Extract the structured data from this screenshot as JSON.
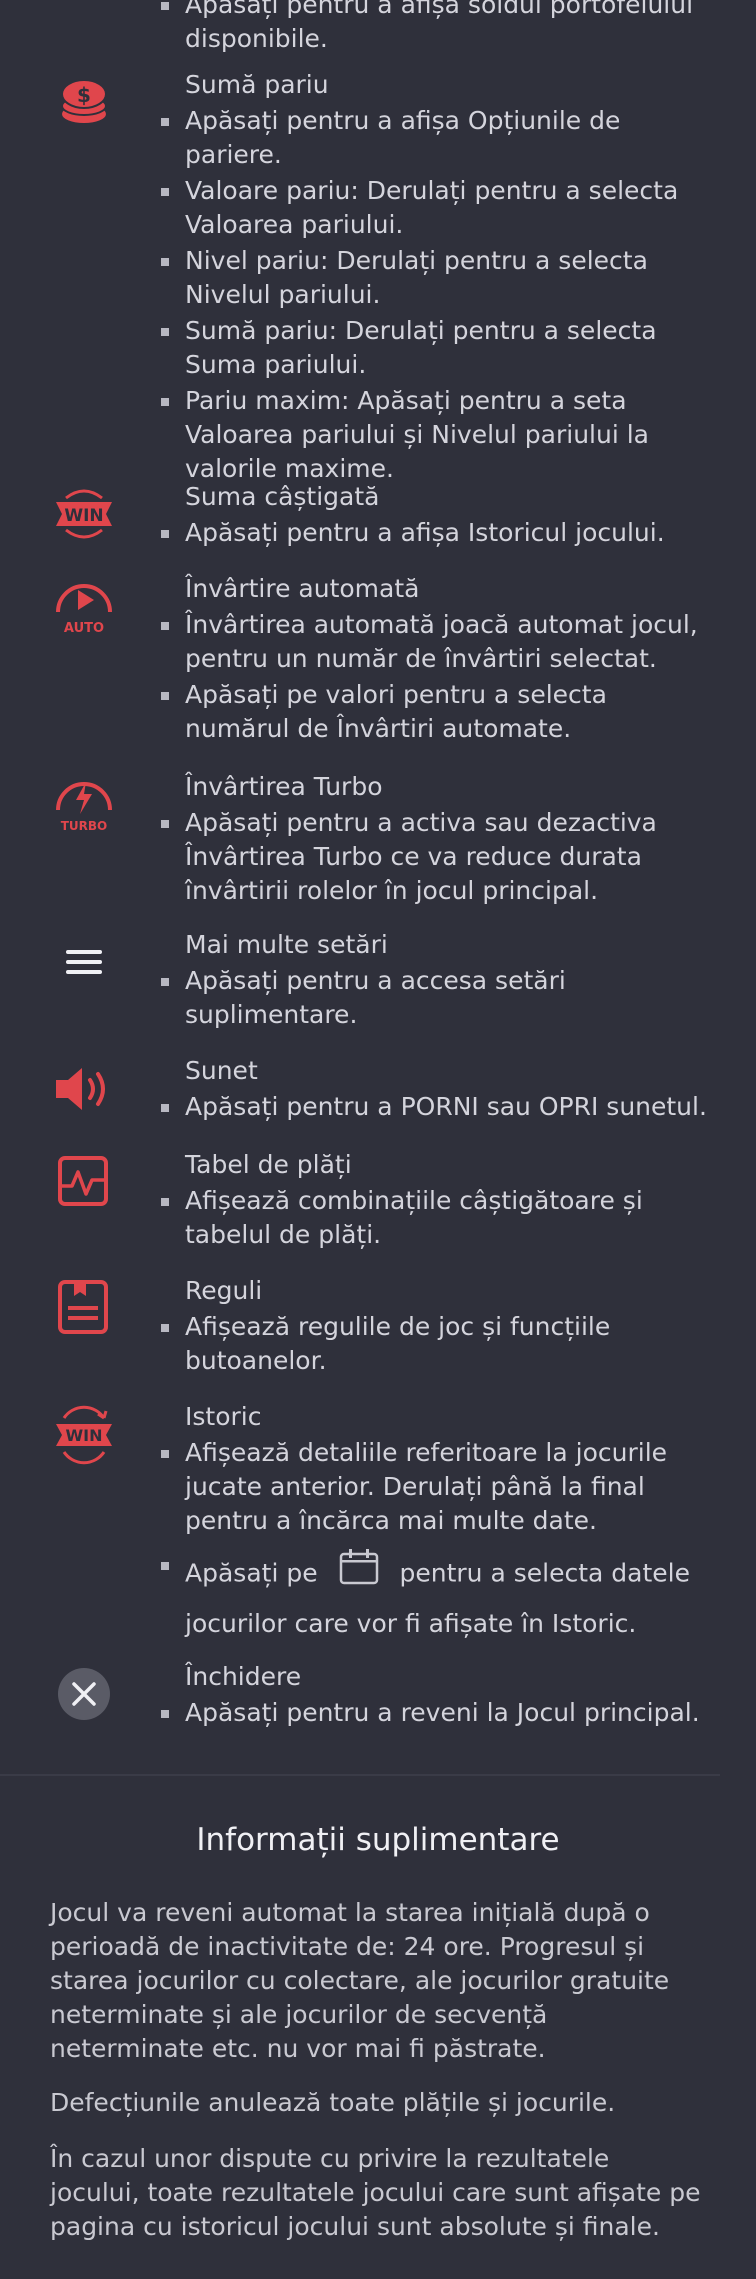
{
  "top": {
    "partial_line": "Apăsați pentru a afișa soldul portofelului",
    "partial_line_2": "disponibile."
  },
  "sections": [
    {
      "title": "Sumă pariu",
      "icon": "coin-stack-icon",
      "bullets": [
        "Apăsați pentru a afișa Opțiunile de pariere.",
        "Valoare pariu: Derulați pentru a selecta Valoarea pariului.",
        "Nivel pariu: Derulați pentru a selecta Nivelul pariului.",
        "Sumă pariu: Derulați pentru a selecta Suma pariului.",
        "Pariu maxim: Apăsați pentru a seta Valoarea pariului și Nivelul pariului la valorile maxime."
      ]
    },
    {
      "title": "Suma câștigată",
      "icon": "win-badge-icon",
      "icon_text": "WIN",
      "bullets": [
        "Apăsați pentru a afișa Istoricul jocului."
      ]
    },
    {
      "title": "Învârtire automată",
      "icon": "auto-spin-icon",
      "icon_text": "AUTO",
      "bullets": [
        "Învârtirea automată joacă automat jocul, pentru un număr de învârtiri selectat.",
        "Apăsați pe valori pentru a selecta numărul de Învârtiri automate."
      ]
    },
    {
      "title": "Învârtirea Turbo",
      "icon": "turbo-spin-icon",
      "icon_text": "TURBO",
      "bullets": [
        "Apăsați pentru a activa sau dezactiva Învârtirea Turbo ce va reduce durata învârtirii rolelor în jocul principal."
      ]
    },
    {
      "title": "Mai multe setări",
      "icon": "menu-icon",
      "bullets": [
        "Apăsați pentru a accesa setări suplimentare."
      ]
    },
    {
      "title": "Sunet",
      "icon": "speaker-icon",
      "bullets": [
        "Apăsați pentru a PORNI sau OPRI sunetul."
      ]
    },
    {
      "title": "Tabel de plăți",
      "icon": "paytable-icon",
      "bullets": [
        "Afișează combinațiile câștigătoare și tabelul de plăți."
      ]
    },
    {
      "title": "Reguli",
      "icon": "rules-icon",
      "bullets": [
        "Afișează regulile de joc și funcțiile butoanelor."
      ]
    },
    {
      "title": "Istoric",
      "icon": "history-win-icon",
      "icon_text": "WIN",
      "bullets": [
        "Afișează detaliile referitoare la jocurile jucate anterior. Derulați până la final pentru a încărca mai multe date."
      ],
      "extra_bullet_pre": "Apăsați pe",
      "extra_bullet_post": "pentru a selecta datele",
      "extra_bullet_line2": "jocurilor care vor fi afișate în Istoric."
    },
    {
      "title": "Închidere",
      "icon": "close-icon",
      "bullets": [
        "Apăsați pentru a reveni la Jocul principal."
      ]
    }
  ],
  "additional": {
    "title": "Informații suplimentare",
    "paragraphs": [
      "Jocul va reveni automat la starea inițială după o perioadă de inactivitate de: 24 ore. Progresul și starea jocurilor cu colectare, ale jocurilor gratuite neterminate și ale jocurilor de secvență neterminate etc. nu vor mai fi păstrate.",
      "Defecțiunile anulează toate plățile și jocurile.",
      "În cazul unor dispute cu privire la rezultatele jocului, toate rezultatele jocului care sunt afișate pe pagina cu istoricul jocului sunt absolute și finale."
    ]
  },
  "colors": {
    "background": "#2f303b",
    "accent": "#e0464c",
    "text": "#d4d4dc",
    "close_bg": "#5a5b66"
  }
}
